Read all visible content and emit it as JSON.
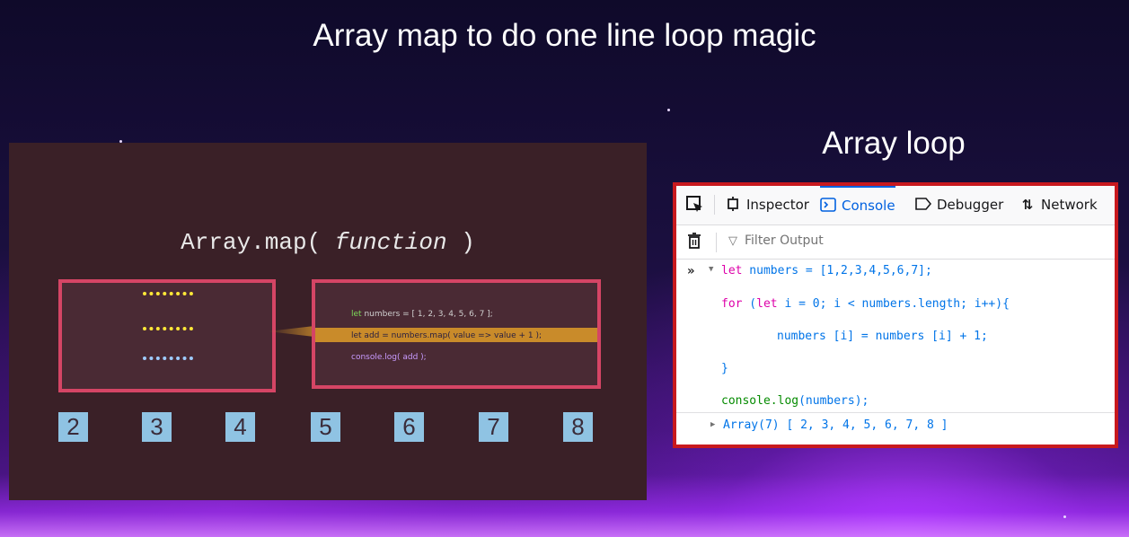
{
  "main_title": "Array map to do one line loop magic",
  "slide": {
    "heading_prefix": "Array.map(",
    "heading_fn": "function",
    "heading_suffix": ")",
    "code": {
      "line1_kw": "let",
      "line1_rest": " numbers = [ 1, 2, 3, 4, 5, 6, 7 ];",
      "line2": "let add = numbers.map( value => value + 1 );",
      "line3": "console.log( add );"
    },
    "numbers": [
      "2",
      "3",
      "4",
      "5",
      "6",
      "7",
      "8"
    ]
  },
  "right_title": "Array loop",
  "devtools": {
    "tabs": [
      {
        "label": "Inspector",
        "icon": "inspector-icon"
      },
      {
        "label": "Console",
        "icon": "console-icon",
        "active": true
      },
      {
        "label": "Debugger",
        "icon": "debugger-icon"
      },
      {
        "label": "Network",
        "icon": "network-icon"
      }
    ],
    "filter_placeholder": "Filter Output",
    "prompt": "»",
    "code_lines": {
      "l1_kw": "let",
      "l1_rest": " numbers = [1,2,3,4,5,6,7];",
      "l2_kw": "for",
      "l2_a": " (",
      "l2_kw2": "let",
      "l2_rest": " i = 0; i < numbers.length; i++){",
      "l3": "numbers [i] = numbers [i] + 1;",
      "l4": "}",
      "l5_fn": "console.log",
      "l5_rest": "(numbers);"
    },
    "output": "Array(7) [ 2, 3, 4, 5, 6, 7, 8 ]"
  },
  "colors": {
    "accent_border": "#c8191e",
    "slide_box_border": "#d54565",
    "number_tile": "#8fc3e3",
    "console_active": "#0061e0"
  }
}
